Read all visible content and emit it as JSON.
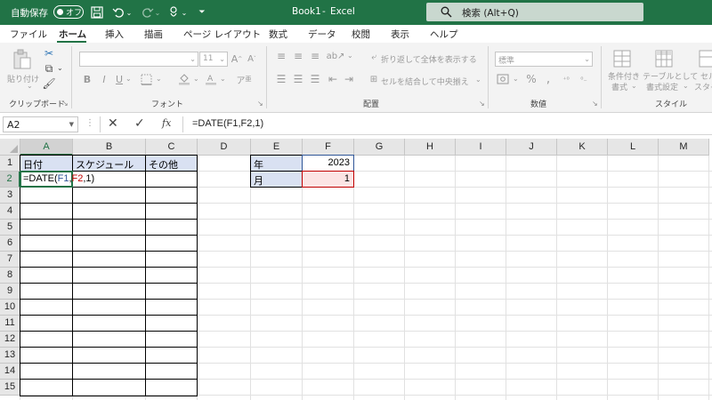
{
  "titlebar": {
    "autosave_label": "自動保存",
    "autosave_state": "オフ",
    "doc_title": "Book1",
    "separator": "-",
    "app_name": "Excel",
    "search_placeholder": "検索 (Alt+Q)"
  },
  "tabs": [
    "ファイル",
    "ホーム",
    "挿入",
    "描画",
    "ページ レイアウト",
    "数式",
    "データ",
    "校閲",
    "表示",
    "ヘルプ"
  ],
  "active_tab": "ホーム",
  "ribbon": {
    "paste_label": "貼り付け",
    "clipboard_group": "クリップボード",
    "font_group": "フォント",
    "font_size": "11",
    "align_group": "配置",
    "wrap_text": "折り返して全体を表示する",
    "merge_center": "セルを結合して中央揃え",
    "number_group": "数値",
    "number_format": "標準",
    "style_group": "スタイル",
    "cond_format_1": "条件付き",
    "cond_format_2": "書式",
    "table_format_1": "テーブルとして",
    "table_format_2": "書式設定",
    "cell_style_1": "セル",
    "cell_style_2": "スタイ"
  },
  "formula_bar": {
    "name_box": "A2",
    "formula": "=DATE(F1,F2,1)"
  },
  "columns": [
    "A",
    "B",
    "C",
    "D",
    "E",
    "F",
    "G",
    "H",
    "I",
    "J",
    "K",
    "L",
    "M"
  ],
  "rows": [
    "1",
    "2",
    "3",
    "4",
    "5",
    "6",
    "7",
    "8",
    "9",
    "10",
    "11",
    "12",
    "13",
    "14",
    "15"
  ],
  "selected_cell": "A2",
  "cells": {
    "A1": "日付",
    "B1": "スケジュール",
    "C1": "その他",
    "E1": "年",
    "F1": "2023",
    "E2": "月",
    "F2": "1"
  },
  "edit_formula": {
    "prefix": "=DATE(",
    "ref1": "F1",
    "comma1": ",",
    "ref2": "F2",
    "tail": ",1)"
  },
  "colors": {
    "brand_green": "#217346",
    "header_fill": "#d9e1f2",
    "ref1_color": "#2f5597",
    "ref2_color": "#c00000",
    "ref2_fill": "#fce4e4"
  }
}
